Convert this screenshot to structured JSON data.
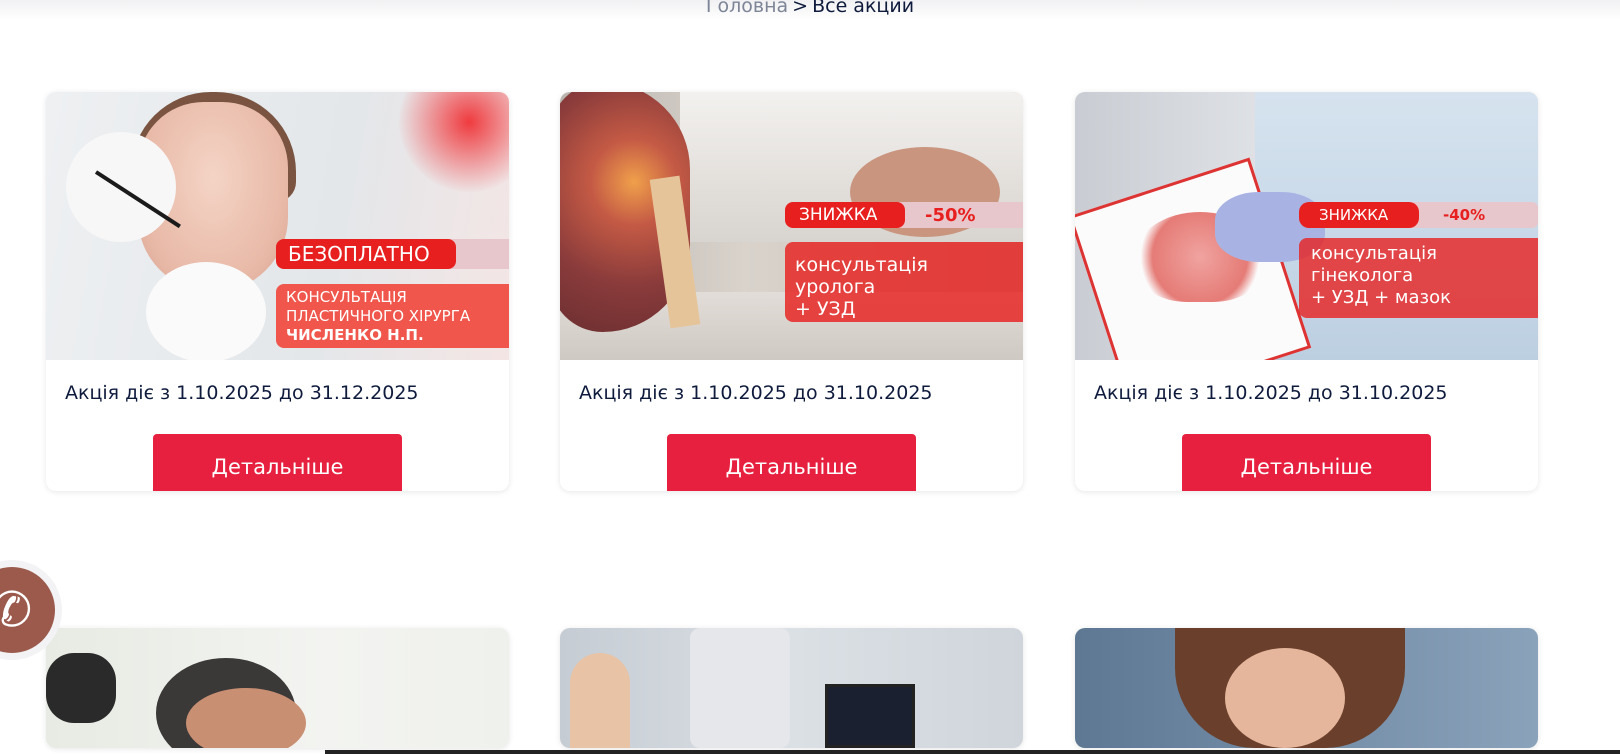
{
  "breadcrumb": {
    "home": "Головна",
    "separator": ">",
    "current": "Все акции"
  },
  "promotions": [
    {
      "image": {
        "badge": "БЕЗОПЛАТНО",
        "text_line1": "КОНСУЛЬТАЦІЯ",
        "text_line2": "ПЛАСТИЧНОГО ХІРУРГА",
        "text_line3": "ЧИСЛЕНКО Н.П."
      },
      "caption": "Акція діє з 1.10.2025 до 31.12.2025",
      "button": "Детальніше"
    },
    {
      "image": {
        "badge": "ЗНИЖКА",
        "discount": "-50%",
        "text_line1": "консультація уролога",
        "text_line2": "+ УЗД"
      },
      "caption": "Акція діє з 1.10.2025 до 31.10.2025",
      "button": "Детальніше"
    },
    {
      "image": {
        "badge": "ЗНИЖКА",
        "discount": "-40%",
        "text_line1": "консультація",
        "text_line2": "гінеколога",
        "text_line3": "+ УЗД + мазок"
      },
      "caption": "Акція діє з 1.10.2025 до 31.10.2025",
      "button": "Детальніше"
    }
  ],
  "colors": {
    "accent": "#e7203f",
    "text": "#0f1b3d",
    "breadcrumb_muted": "#7d8597",
    "phone_button": "#9b5a4c"
  },
  "icons": {
    "phone": "phone-icon"
  }
}
